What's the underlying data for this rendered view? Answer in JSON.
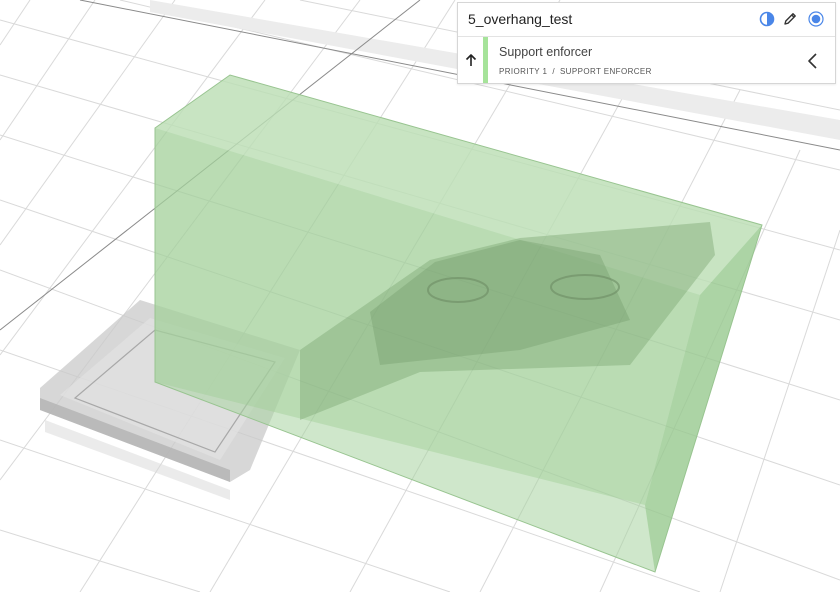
{
  "object": {
    "name": "5_overhang_test"
  },
  "header_icons": [
    "contrast-icon",
    "pencil-icon",
    "radio-dot-icon"
  ],
  "modifier": {
    "title": "Support enforcer",
    "priority_label": "PRIORITY 1",
    "separator": "/",
    "type_label": "SUPPORT ENFORCER",
    "accent_color": "#a6e39a"
  },
  "colors": {
    "icon_blue": "#4a86e8",
    "enforcer_fill": "#a8d4a0",
    "base_gray": "#bdbdbd"
  }
}
